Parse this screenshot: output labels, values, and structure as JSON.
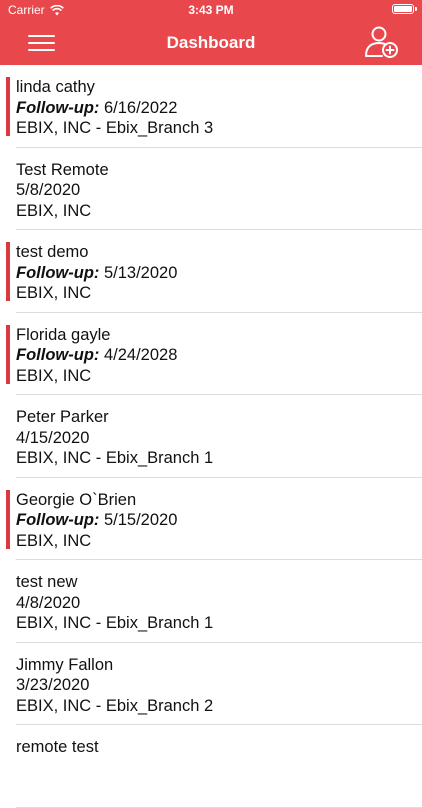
{
  "status_bar": {
    "carrier": "Carrier",
    "time": "3:43 PM"
  },
  "nav": {
    "title": "Dashboard"
  },
  "icons": {
    "menu": "hamburger-menu-icon",
    "add_user": "add-user-icon",
    "wifi": "wifi-icon",
    "battery": "battery-icon"
  },
  "colors": {
    "brand": "#e8474c",
    "accent_bar": "#d93a3f"
  },
  "follow_up_label": "Follow-up:",
  "items": [
    {
      "name": "linda cathy",
      "has_follow_up": true,
      "date": "6/16/2022",
      "company": "EBIX, INC - Ebix_Branch 3"
    },
    {
      "name": "Test Remote",
      "has_follow_up": false,
      "date": "5/8/2020",
      "company": "EBIX, INC"
    },
    {
      "name": "test demo",
      "has_follow_up": true,
      "date": "5/13/2020",
      "company": "EBIX, INC"
    },
    {
      "name": "Florida gayle",
      "has_follow_up": true,
      "date": "4/24/2028",
      "company": "EBIX, INC"
    },
    {
      "name": "Peter Parker",
      "has_follow_up": false,
      "date": "4/15/2020",
      "company": "EBIX, INC - Ebix_Branch 1"
    },
    {
      "name": "Georgie O`Brien",
      "has_follow_up": true,
      "date": "5/15/2020",
      "company": "EBIX, INC"
    },
    {
      "name": "test new",
      "has_follow_up": false,
      "date": "4/8/2020",
      "company": "EBIX, INC - Ebix_Branch 1"
    },
    {
      "name": "Jimmy Fallon",
      "has_follow_up": false,
      "date": "3/23/2020",
      "company": "EBIX, INC - Ebix_Branch 2"
    },
    {
      "name": "remote test",
      "has_follow_up": false,
      "date": "",
      "company": ""
    }
  ]
}
